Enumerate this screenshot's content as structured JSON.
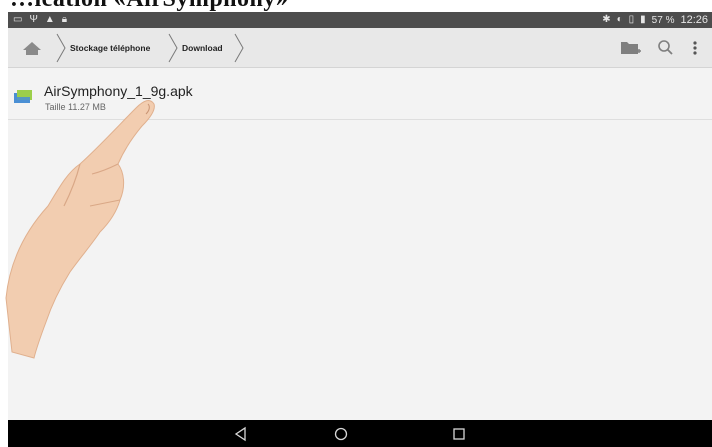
{
  "caption": "…ication «AirSymphony»",
  "status_bar": {
    "icons_left": [
      "screen-icon",
      "usb-icon",
      "warning-icon",
      "lock-icon"
    ],
    "icons_right": [
      "bluetooth-icon",
      "sync-icon",
      "signal-icon",
      "battery-icon"
    ],
    "battery": "57 %",
    "time": "12:26"
  },
  "breadcrumb": {
    "items": [
      {
        "label": "Stockage téléphone"
      },
      {
        "label": "Download"
      }
    ]
  },
  "toolbar": {
    "icons": [
      "new-folder-icon",
      "search-icon",
      "overflow-menu-icon"
    ]
  },
  "files": [
    {
      "name": "AirSymphony_1_9g.apk",
      "meta": "Taille 11.27 MB"
    }
  ],
  "colors": {
    "status_bar": "#4d4d4d",
    "action_bar": "#e8e8e8",
    "list_bg": "#f3f3f3",
    "nav_bar": "#000000",
    "skin": "#f0c9a8"
  }
}
